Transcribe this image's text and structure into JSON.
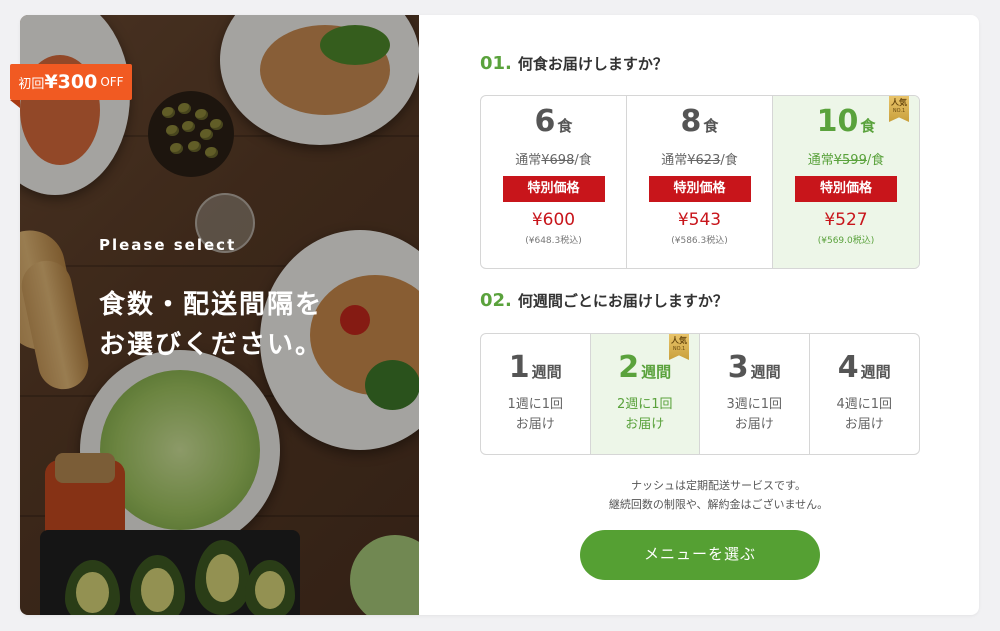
{
  "promo": {
    "prefix": "初回",
    "amount": "¥300",
    "suffix": "OFF"
  },
  "hero": {
    "subtitle": "Please select",
    "title_line1": "食数・配送間隔を",
    "title_line2": "お選びください。"
  },
  "q1": {
    "num": "01.",
    "label": "何食お届けしますか？",
    "options": [
      {
        "count": "6",
        "unit": "食",
        "regular_prefix": "通常",
        "regular_price": "¥698",
        "regular_suffix": "/食",
        "badge": "特別価格",
        "price": "¥600",
        "tax_in": "(¥648.3税込)",
        "selected": false
      },
      {
        "count": "8",
        "unit": "食",
        "regular_prefix": "通常",
        "regular_price": "¥623",
        "regular_suffix": "/食",
        "badge": "特別価格",
        "price": "¥543",
        "tax_in": "(¥586.3税込)",
        "selected": false
      },
      {
        "count": "10",
        "unit": "食",
        "regular_prefix": "通常",
        "regular_price": "¥599",
        "regular_suffix": "/食",
        "badge": "特別価格",
        "price": "¥527",
        "tax_in": "(¥569.0税込)",
        "selected": true,
        "ribbon_top": "人気",
        "ribbon_bottom": "NO.1"
      }
    ]
  },
  "q2": {
    "num": "02.",
    "label": "何週間ごとにお届けしますか？",
    "options": [
      {
        "count": "1",
        "unit": "週間",
        "desc_line1": "1週に1回",
        "desc_line2": "お届け",
        "selected": false
      },
      {
        "count": "2",
        "unit": "週間",
        "desc_line1": "2週に1回",
        "desc_line2": "お届け",
        "selected": true,
        "ribbon_top": "人気",
        "ribbon_bottom": "NO.1"
      },
      {
        "count": "3",
        "unit": "週間",
        "desc_line1": "3週に1回",
        "desc_line2": "お届け",
        "selected": false
      },
      {
        "count": "4",
        "unit": "週間",
        "desc_line1": "4週に1回",
        "desc_line2": "お届け",
        "selected": false
      }
    ]
  },
  "note": {
    "line1": "ナッシュは定期配送サービスです。",
    "line2": "継続回数の制限や、解約金はございません。"
  },
  "cta": {
    "label": "メニューを選ぶ"
  },
  "colors": {
    "accent_green": "#55a033",
    "price_red": "#c8151b",
    "promo_orange": "#f15a22",
    "selected_bg": "#edf6e8"
  }
}
